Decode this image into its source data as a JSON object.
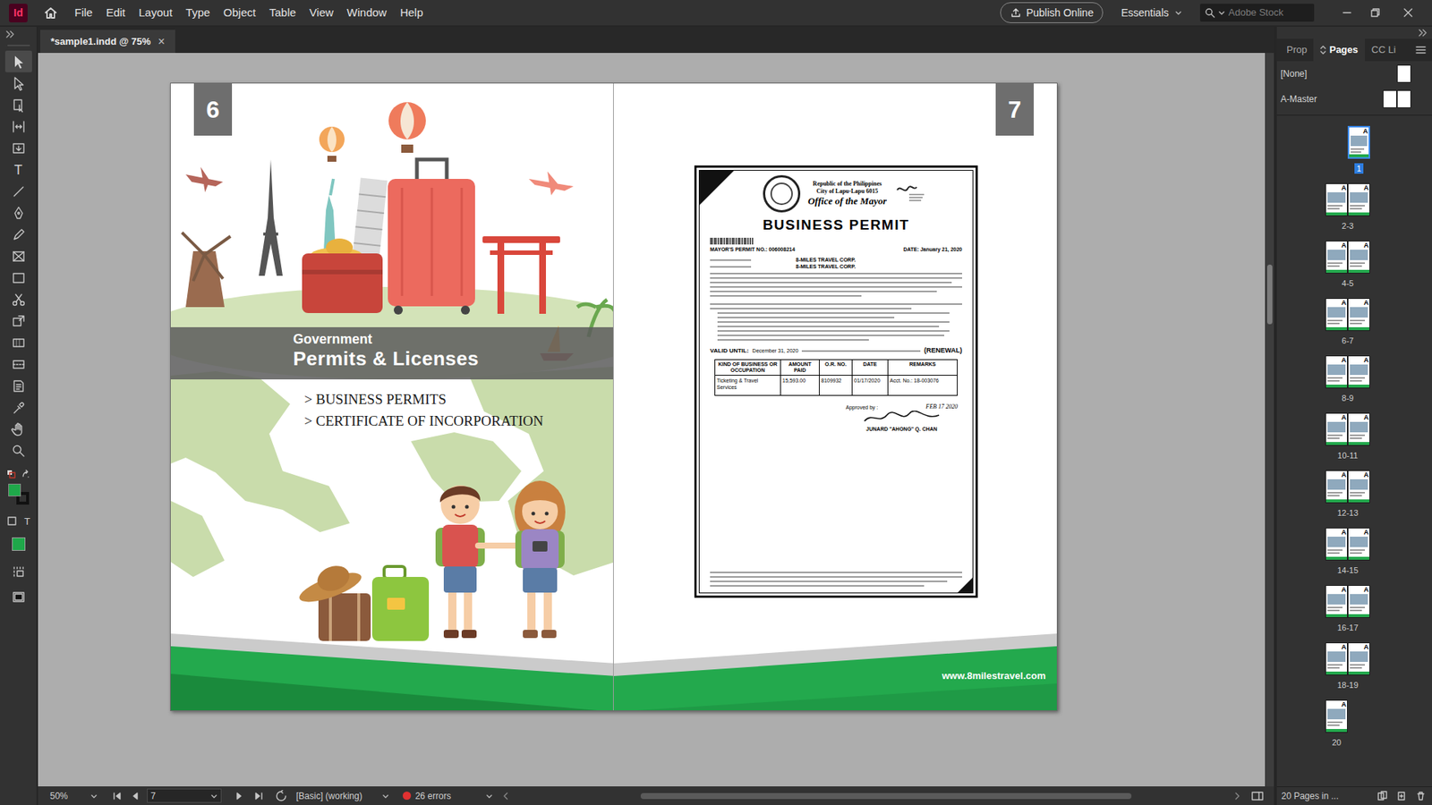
{
  "app": {
    "logo": "Id"
  },
  "menu": [
    "File",
    "Edit",
    "Layout",
    "Type",
    "Object",
    "Table",
    "View",
    "Window",
    "Help"
  ],
  "topbar": {
    "publish": "Publish Online",
    "workspace": "Essentials",
    "search_placeholder": "Adobe Stock"
  },
  "document_tab": {
    "title": "*sample1.indd @ 75%",
    "close": "×",
    "selected": true
  },
  "tools": [
    {
      "selected": true
    },
    {
      "selected": false
    },
    {
      "selected": false
    },
    {
      "selected": false
    },
    {
      "selected": false
    },
    {
      "selected": false,
      "glyph": "T"
    },
    {
      "selected": false
    },
    {
      "selected": false
    },
    {
      "selected": false
    },
    {
      "selected": false
    },
    {
      "selected": false
    },
    {
      "selected": false
    },
    {
      "selected": false
    },
    {
      "selected": false
    },
    {
      "selected": false
    },
    {
      "selected": false
    },
    {
      "selected": false
    },
    {
      "selected": false
    },
    {
      "selected": false
    }
  ],
  "swatches": {
    "fill": "#1fa84a",
    "stroke": "#111111",
    "format_glyph": "T"
  },
  "spread": {
    "left_page": {
      "number": "6",
      "banner_small": "Government",
      "banner_title": "Permits & Licenses",
      "list": [
        "> BUSINESS PERMITS",
        "> CERTIFICATE OF INCORPORATION"
      ]
    },
    "right_page": {
      "number": "7",
      "website": "www.8milestravel.com",
      "permit": {
        "header": [
          "Republic of the Philippines",
          "City of Lapu-Lapu 6015"
        ],
        "office": "Office of the Mayor",
        "title": "BUSINESS PERMIT",
        "permit_no": "MAYOR'S PERMIT NO.: 006008214",
        "date": "DATE: January 21, 2020",
        "business_names": [
          "8-MILES TRAVEL CORP.",
          "8-MILES TRAVEL CORP."
        ],
        "valid_label": "VALID UNTIL:",
        "valid_date": "December 31, 2020",
        "renewal": "(RENEWAL)",
        "table": {
          "columns": [
            "KIND OF BUSINESS OR OCCUPATION",
            "AMOUNT PAID",
            "O.R. NO.",
            "DATE",
            "REMARKS"
          ],
          "rows": [
            [
              "Ticketing & Travel Services",
              "15,593.00",
              "8109932",
              "01/17/2020",
              "Acct. No.: 18-003076"
            ]
          ]
        },
        "approved_by": "Approved by :",
        "stamp_date": "FEB 17 2020",
        "signatory": "JUNARD \"AHONG\" Q. CHAN"
      }
    }
  },
  "panel": {
    "tabs": [
      {
        "label": "Prop",
        "selected": false
      },
      {
        "label": "Pages",
        "selected": true
      },
      {
        "label": "CC Li",
        "selected": false
      }
    ],
    "masters": [
      {
        "label": "[None]",
        "kind": "single"
      },
      {
        "label": "A-Master",
        "kind": "spread"
      }
    ],
    "pages": [
      {
        "label": "1",
        "kind": "single-right",
        "masters": [
          "A"
        ],
        "selected": true
      },
      {
        "label": "2-3",
        "kind": "spread",
        "masters": [
          "A",
          "A"
        ],
        "selected": false
      },
      {
        "label": "4-5",
        "kind": "spread",
        "masters": [
          "A",
          "A"
        ],
        "selected": false
      },
      {
        "label": "6-7",
        "kind": "spread",
        "masters": [
          "A",
          "A"
        ],
        "selected": false
      },
      {
        "label": "8-9",
        "kind": "spread",
        "masters": [
          "A",
          "A"
        ],
        "selected": false
      },
      {
        "label": "10-11",
        "kind": "spread",
        "masters": [
          "A",
          "A"
        ],
        "selected": false
      },
      {
        "label": "12-13",
        "kind": "spread",
        "masters": [
          "A",
          "A"
        ],
        "selected": false
      },
      {
        "label": "14-15",
        "kind": "spread",
        "masters": [
          "A",
          "A"
        ],
        "selected": false
      },
      {
        "label": "16-17",
        "kind": "spread",
        "masters": [
          "A",
          "A"
        ],
        "selected": false
      },
      {
        "label": "18-19",
        "kind": "spread",
        "masters": [
          "A",
          "A"
        ],
        "selected": false
      },
      {
        "label": "20",
        "kind": "single-left",
        "masters": [
          "A"
        ],
        "selected": false
      }
    ],
    "footer": "20 Pages in ..."
  },
  "status": {
    "zoom": "50%",
    "page": "7",
    "profile": "[Basic] (working)",
    "errors": "26 errors",
    "has_errors": true
  }
}
